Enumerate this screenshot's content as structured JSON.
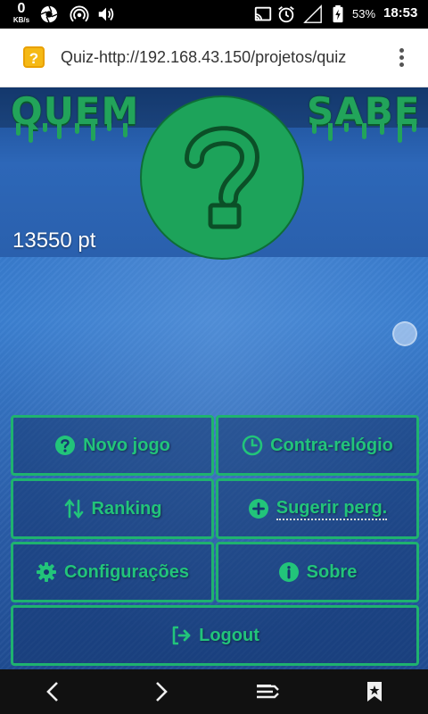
{
  "status_bar": {
    "speed_value": "0",
    "speed_unit": "KB/s",
    "battery_percent": "53%",
    "time": "18:53",
    "icons": [
      "aperture-icon",
      "hotspot-icon",
      "volume-icon",
      "cast-icon",
      "alarm-icon",
      "signal-icon",
      "battery-icon"
    ]
  },
  "address_bar": {
    "url": "Quiz-http://192.168.43.150/projetos/quiz",
    "favicon_glyph": "?"
  },
  "header": {
    "logo_left": "QUEM",
    "logo_right": "SABE",
    "logo_color": "#22a45a",
    "score": "13550 pt"
  },
  "menu": [
    {
      "id": "novo-jogo",
      "label": "Novo jogo",
      "icon": "question-circle-icon"
    },
    {
      "id": "contra-relogio",
      "label": "Contra-relógio",
      "icon": "clock-icon"
    },
    {
      "id": "ranking",
      "label": "Ranking",
      "icon": "sort-arrows-icon"
    },
    {
      "id": "sugerir-perg",
      "label": "Sugerir perg.",
      "icon": "plus-circle-icon"
    },
    {
      "id": "configuracoes",
      "label": "Configurações",
      "icon": "gear-icon"
    },
    {
      "id": "sobre",
      "label": "Sobre",
      "icon": "info-circle-icon"
    },
    {
      "id": "logout",
      "label": "Logout",
      "icon": "logout-icon"
    }
  ],
  "colors": {
    "accent_green": "#1fb26f",
    "background_blue": "#2f6fc4"
  },
  "bottom_nav": [
    "back-icon",
    "forward-icon",
    "tabs-icon",
    "bookmark-icon"
  ]
}
